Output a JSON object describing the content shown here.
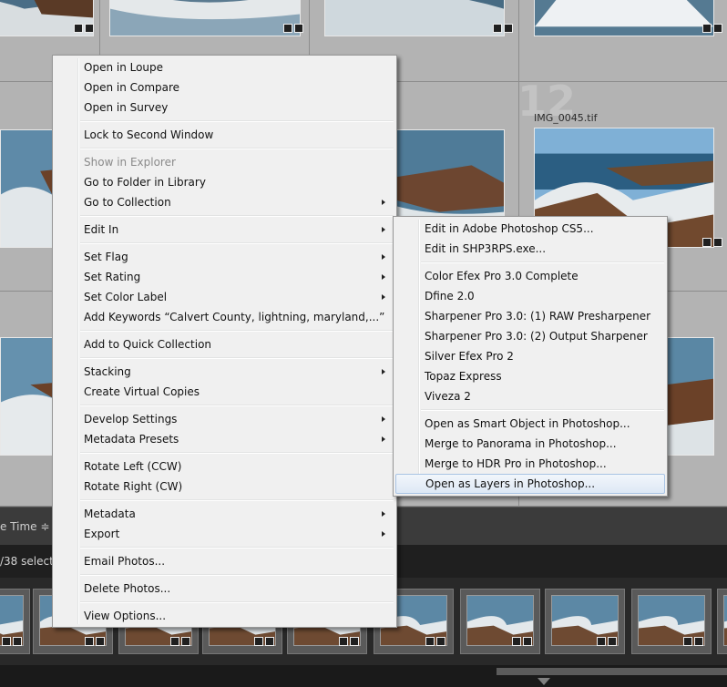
{
  "grid": {
    "cell_number": "12",
    "filename": "IMG_0045.tif"
  },
  "toolbar": {
    "sort_label": "e Time ≑"
  },
  "infobar": {
    "selection_text": "/38 select"
  },
  "context_menu": {
    "items": [
      {
        "label": "Open in Loupe"
      },
      {
        "label": "Open in Compare"
      },
      {
        "label": "Open in Survey"
      },
      {
        "label": "Lock to Second Window"
      },
      {
        "label": "Show in Explorer",
        "disabled": true
      },
      {
        "label": "Go to Folder in Library"
      },
      {
        "label": "Go to Collection",
        "submenu": true
      },
      {
        "label": "Edit In",
        "submenu": true
      },
      {
        "label": "Set Flag",
        "submenu": true
      },
      {
        "label": "Set Rating",
        "submenu": true
      },
      {
        "label": "Set Color Label",
        "submenu": true
      },
      {
        "label": "Add Keywords “Calvert County, lightning, maryland,...”"
      },
      {
        "label": "Add to Quick Collection"
      },
      {
        "label": "Stacking",
        "submenu": true
      },
      {
        "label": "Create Virtual Copies"
      },
      {
        "label": "Develop Settings",
        "submenu": true
      },
      {
        "label": "Metadata Presets",
        "submenu": true
      },
      {
        "label": "Rotate Left (CCW)"
      },
      {
        "label": "Rotate Right (CW)"
      },
      {
        "label": "Metadata",
        "submenu": true
      },
      {
        "label": "Export",
        "submenu": true
      },
      {
        "label": "Email Photos..."
      },
      {
        "label": "Delete Photos..."
      },
      {
        "label": "View Options..."
      }
    ]
  },
  "edit_in_submenu": {
    "items": [
      {
        "label": "Edit in Adobe Photoshop CS5..."
      },
      {
        "label": "Edit in SHP3RPS.exe..."
      },
      {
        "label": "Color Efex Pro 3.0 Complete"
      },
      {
        "label": "Dfine 2.0"
      },
      {
        "label": "Sharpener Pro 3.0: (1) RAW Presharpener"
      },
      {
        "label": "Sharpener Pro 3.0: (2) Output Sharpener"
      },
      {
        "label": "Silver Efex Pro 2"
      },
      {
        "label": "Topaz Express"
      },
      {
        "label": "Viveza 2"
      },
      {
        "label": "Open as Smart Object in Photoshop..."
      },
      {
        "label": "Merge to Panorama in Photoshop..."
      },
      {
        "label": "Merge to HDR Pro in Photoshop..."
      },
      {
        "label": "Open as Layers in Photoshop...",
        "highlighted": true
      }
    ]
  },
  "colors": {
    "menu_bg": "#f0f0f0",
    "highlight_border": "#a9c4e4",
    "grid_bg": "#b3b3b3"
  }
}
